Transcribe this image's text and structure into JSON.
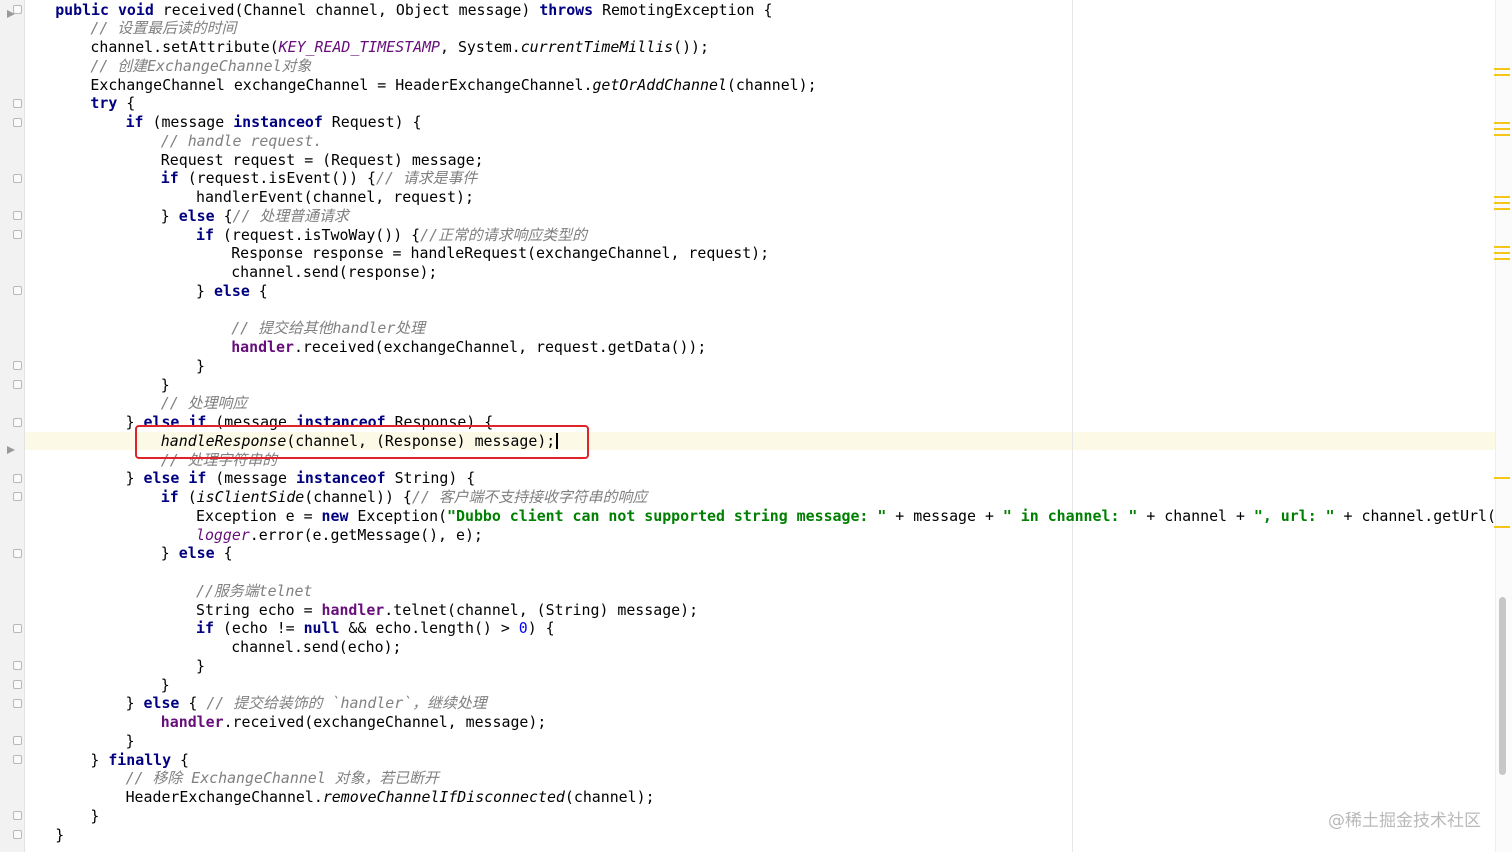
{
  "editor": {
    "lines": [
      {
        "id": "l1",
        "tokens": [
          {
            "c": "kw",
            "t": "public void"
          },
          {
            "c": "",
            "t": " received(Channel channel, Object message) "
          },
          {
            "c": "kw",
            "t": "throws"
          },
          {
            "c": "",
            "t": " RemotingException {"
          }
        ]
      },
      {
        "id": "l2",
        "tokens": [
          {
            "c": "cm",
            "t": "// 设置最后读的时间"
          }
        ]
      },
      {
        "id": "l3",
        "tokens": [
          {
            "c": "",
            "t": "channel.setAttribute("
          },
          {
            "c": "fd",
            "t": "KEY_READ_TIMESTAMP"
          },
          {
            "c": "",
            "t": ", System."
          },
          {
            "c": "mi",
            "t": "currentTimeMillis"
          },
          {
            "c": "",
            "t": "());"
          }
        ]
      },
      {
        "id": "l4",
        "tokens": [
          {
            "c": "cm",
            "t": "// 创建ExchangeChannel对象"
          }
        ]
      },
      {
        "id": "l5",
        "tokens": [
          {
            "c": "",
            "t": "ExchangeChannel exchangeChannel = HeaderExchangeChannel."
          },
          {
            "c": "mi",
            "t": "getOrAddChannel"
          },
          {
            "c": "",
            "t": "(channel);"
          }
        ]
      },
      {
        "id": "l6",
        "tokens": [
          {
            "c": "kw",
            "t": "try"
          },
          {
            "c": "",
            "t": " {"
          }
        ]
      },
      {
        "id": "l7",
        "tokens": [
          {
            "c": "kw",
            "t": "if"
          },
          {
            "c": "",
            "t": " (message "
          },
          {
            "c": "kw",
            "t": "instanceof"
          },
          {
            "c": "",
            "t": " Request) {"
          }
        ]
      },
      {
        "id": "l8",
        "tokens": [
          {
            "c": "cm",
            "t": "// handle request."
          }
        ]
      },
      {
        "id": "l9",
        "tokens": [
          {
            "c": "",
            "t": "Request request = (Request) message;"
          }
        ]
      },
      {
        "id": "l10",
        "tokens": [
          {
            "c": "kw",
            "t": "if"
          },
          {
            "c": "",
            "t": " (request.isEvent()) {"
          },
          {
            "c": "cm",
            "t": "// 请求是事件"
          }
        ]
      },
      {
        "id": "l11",
        "tokens": [
          {
            "c": "",
            "t": "handlerEvent(channel, request);"
          }
        ]
      },
      {
        "id": "l12",
        "tokens": [
          {
            "c": "",
            "t": "} "
          },
          {
            "c": "kw",
            "t": "else"
          },
          {
            "c": "",
            "t": " {"
          },
          {
            "c": "cm",
            "t": "// 处理普通请求"
          }
        ]
      },
      {
        "id": "l13",
        "tokens": [
          {
            "c": "kw",
            "t": "if"
          },
          {
            "c": "",
            "t": " (request.isTwoWay()) {"
          },
          {
            "c": "cm",
            "t": "//正常的请求响应类型的"
          }
        ]
      },
      {
        "id": "l14",
        "tokens": [
          {
            "c": "",
            "t": "Response response = handleRequest(exchangeChannel, request);"
          }
        ]
      },
      {
        "id": "l15",
        "tokens": [
          {
            "c": "",
            "t": "channel.send(response);"
          }
        ]
      },
      {
        "id": "l16",
        "tokens": [
          {
            "c": "",
            "t": "} "
          },
          {
            "c": "kw",
            "t": "else"
          },
          {
            "c": "",
            "t": " {"
          }
        ]
      },
      {
        "id": "l17",
        "tokens": [
          {
            "c": "",
            "t": ""
          }
        ]
      },
      {
        "id": "l18",
        "tokens": [
          {
            "c": "cm",
            "t": "// 提交给其他handler处理"
          }
        ]
      },
      {
        "id": "l19",
        "tokens": [
          {
            "c": "hf",
            "t": "handler"
          },
          {
            "c": "",
            "t": ".received(exchangeChannel, request.getData());"
          }
        ]
      },
      {
        "id": "l20",
        "tokens": [
          {
            "c": "",
            "t": "}"
          }
        ]
      },
      {
        "id": "l21",
        "tokens": [
          {
            "c": "",
            "t": "}"
          }
        ]
      },
      {
        "id": "l22",
        "tokens": [
          {
            "c": "cm",
            "t": "// 处理响应"
          }
        ]
      },
      {
        "id": "l23",
        "tokens": [
          {
            "c": "",
            "t": "} "
          },
          {
            "c": "kw",
            "t": "else if"
          },
          {
            "c": "",
            "t": " (message "
          },
          {
            "c": "kw",
            "t": "instanceof"
          },
          {
            "c": "",
            "t": " Response) {"
          }
        ]
      },
      {
        "id": "l24",
        "tokens": [
          {
            "c": "mi",
            "t": "handleResponse"
          },
          {
            "c": "",
            "t": "(channel, (Response) message);"
          }
        ]
      },
      {
        "id": "l25",
        "tokens": [
          {
            "c": "cm",
            "t": "// 处理字符串的"
          }
        ]
      },
      {
        "id": "l26",
        "tokens": [
          {
            "c": "",
            "t": "} "
          },
          {
            "c": "kw",
            "t": "else if"
          },
          {
            "c": "",
            "t": " (message "
          },
          {
            "c": "kw",
            "t": "instanceof"
          },
          {
            "c": "",
            "t": " String) {"
          }
        ]
      },
      {
        "id": "l27",
        "tokens": [
          {
            "c": "kw",
            "t": "if"
          },
          {
            "c": "",
            "t": " ("
          },
          {
            "c": "mi",
            "t": "isClientSide"
          },
          {
            "c": "",
            "t": "(channel)) {"
          },
          {
            "c": "cm",
            "t": "// 客户端不支持接收字符串的响应"
          }
        ]
      },
      {
        "id": "l28",
        "tokens": [
          {
            "c": "",
            "t": "Exception e = "
          },
          {
            "c": "kw",
            "t": "new"
          },
          {
            "c": "",
            "t": " Exception("
          },
          {
            "c": "st",
            "t": "\"Dubbo client can not supported string message: \""
          },
          {
            "c": "",
            "t": " + message + "
          },
          {
            "c": "st",
            "t": "\" in channel: \""
          },
          {
            "c": "",
            "t": " + channel + "
          },
          {
            "c": "st",
            "t": "\", url: \""
          },
          {
            "c": "",
            "t": " + channel.getUrl());"
          }
        ]
      },
      {
        "id": "l29",
        "tokens": [
          {
            "c": "fd",
            "t": "logger"
          },
          {
            "c": "",
            "t": ".error(e.getMessage(), e);"
          }
        ]
      },
      {
        "id": "l30",
        "tokens": [
          {
            "c": "",
            "t": "} "
          },
          {
            "c": "kw",
            "t": "else"
          },
          {
            "c": "",
            "t": " {"
          }
        ]
      },
      {
        "id": "l31",
        "tokens": [
          {
            "c": "",
            "t": ""
          }
        ]
      },
      {
        "id": "l32",
        "tokens": [
          {
            "c": "cm",
            "t": "//服务端telnet"
          }
        ]
      },
      {
        "id": "l33",
        "tokens": [
          {
            "c": "",
            "t": "String echo = "
          },
          {
            "c": "hf",
            "t": "handler"
          },
          {
            "c": "",
            "t": ".telnet(channel, (String) message);"
          }
        ]
      },
      {
        "id": "l34",
        "tokens": [
          {
            "c": "kw",
            "t": "if"
          },
          {
            "c": "",
            "t": " (echo != "
          },
          {
            "c": "kw",
            "t": "null"
          },
          {
            "c": "",
            "t": " && echo.length() > "
          },
          {
            "c": "nm",
            "t": "0"
          },
          {
            "c": "",
            "t": ") {"
          }
        ]
      },
      {
        "id": "l35",
        "tokens": [
          {
            "c": "",
            "t": "channel.send(echo);"
          }
        ]
      },
      {
        "id": "l36",
        "tokens": [
          {
            "c": "",
            "t": "}"
          }
        ]
      },
      {
        "id": "l37",
        "tokens": [
          {
            "c": "",
            "t": "}"
          }
        ]
      },
      {
        "id": "l38",
        "tokens": [
          {
            "c": "",
            "t": "} "
          },
          {
            "c": "kw",
            "t": "else"
          },
          {
            "c": "",
            "t": " { "
          },
          {
            "c": "cm",
            "t": "// 提交给装饰的 `handler`，继续处理"
          }
        ]
      },
      {
        "id": "l39",
        "tokens": [
          {
            "c": "hf",
            "t": "handler"
          },
          {
            "c": "",
            "t": ".received(exchangeChannel, message);"
          }
        ]
      },
      {
        "id": "l40",
        "tokens": [
          {
            "c": "",
            "t": "}"
          }
        ]
      },
      {
        "id": "l41",
        "tokens": [
          {
            "c": "",
            "t": "} "
          },
          {
            "c": "kw",
            "t": "finally"
          },
          {
            "c": "",
            "t": " {"
          }
        ]
      },
      {
        "id": "l42",
        "tokens": [
          {
            "c": "cm",
            "t": "// 移除 ExchangeChannel 对象，若已断开"
          }
        ]
      },
      {
        "id": "l43",
        "tokens": [
          {
            "c": "",
            "t": "HeaderExchangeChannel."
          },
          {
            "c": "mi",
            "t": "removeChannelIfDisconnected"
          },
          {
            "c": "",
            "t": "(channel);"
          }
        ]
      },
      {
        "id": "l44",
        "tokens": [
          {
            "c": "",
            "t": "}"
          }
        ]
      },
      {
        "id": "l45",
        "tokens": [
          {
            "c": "",
            "t": "}"
          }
        ]
      }
    ],
    "indent": [
      1,
      2,
      2,
      2,
      2,
      2,
      3,
      4,
      4,
      4,
      5,
      4,
      5,
      6,
      6,
      5,
      6,
      6,
      6,
      5,
      4,
      4,
      3,
      4,
      4,
      3,
      4,
      5,
      5,
      4,
      5,
      5,
      5,
      5,
      6,
      5,
      4,
      3,
      4,
      3,
      2,
      3,
      3,
      2,
      1
    ],
    "highlighted_line": "l24"
  },
  "watermark": {
    "text": "@稀土掘金技术社区"
  },
  "colors": {
    "keyword": "#000080",
    "comment": "#808080",
    "string": "#008000",
    "number": "#0000ff",
    "field": "#660e7a",
    "highlight_box": "#e0242c",
    "current_line": "#fcfae6"
  }
}
